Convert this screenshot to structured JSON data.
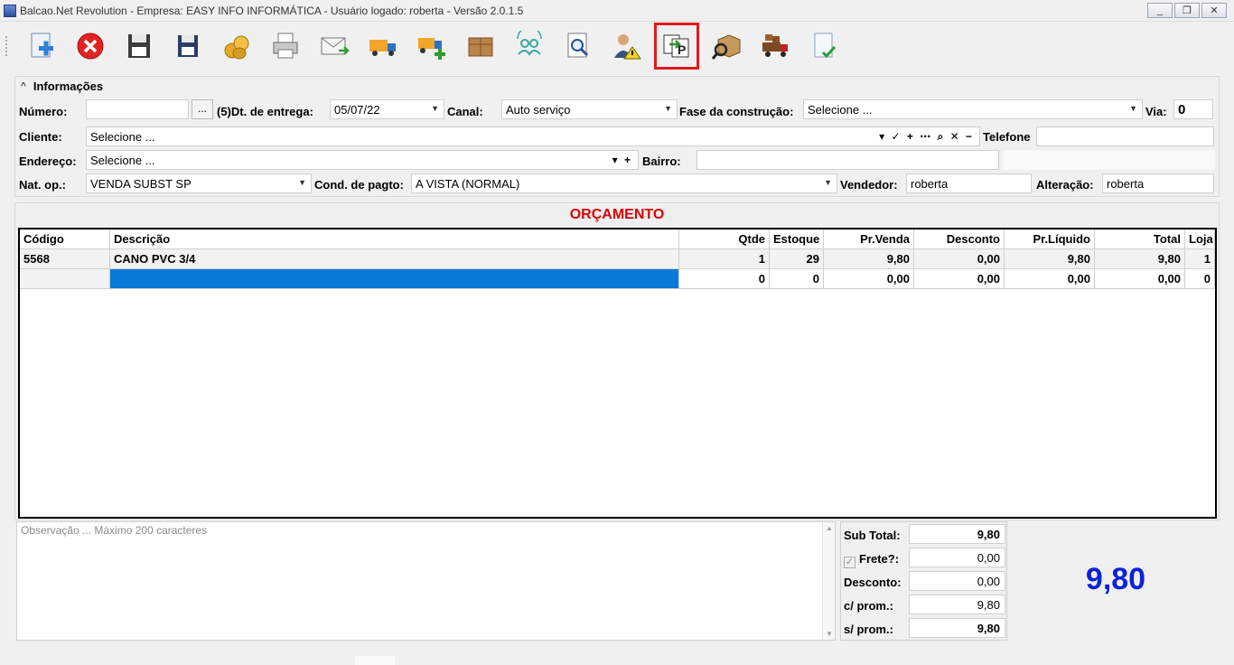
{
  "window": {
    "title": "Balcao.Net Revolution - Empresa: EASY INFO INFORMÁTICA - Usuário logado: roberta - Versão 2.0.1.5",
    "minimize": "_",
    "maximize": "❐",
    "close": "✕"
  },
  "toolbar": {
    "items": [
      {
        "name": "new-document-icon"
      },
      {
        "name": "cancel-icon"
      },
      {
        "name": "save-icon"
      },
      {
        "name": "save-as-icon"
      },
      {
        "name": "coins-icon"
      },
      {
        "name": "print-icon"
      },
      {
        "name": "email-icon"
      },
      {
        "name": "truck-icon"
      },
      {
        "name": "truck-add-icon"
      },
      {
        "name": "boxes-icon"
      },
      {
        "name": "users-sync-icon"
      },
      {
        "name": "document-search-icon"
      },
      {
        "name": "user-warning-icon"
      },
      {
        "name": "document-transfer-icon"
      },
      {
        "name": "package-search-icon"
      },
      {
        "name": "delivery-truck-icon"
      },
      {
        "name": "document-check-icon"
      }
    ],
    "highlighted_index": 13
  },
  "info": {
    "title": "Informações",
    "numero_label": "Número:",
    "numero_value": "",
    "dots": "...",
    "dt_entrega_label": "(5)Dt. de entrega:",
    "dt_entrega_value": "05/07/22",
    "canal_label": "Canal:",
    "canal_value": "Auto serviço",
    "fase_label": "Fase da construção:",
    "fase_value": "Selecione ...",
    "via_label": "Via:",
    "via_value": "0",
    "cliente_label": "Cliente:",
    "cliente_value": "Selecione ...",
    "cliente_actions": "▾ ✓ + ⋯ ⌕ ✕ −",
    "telefone_label": "Telefone",
    "telefone_value": "",
    "endereco_label": "Endereço:",
    "endereco_value": "Selecione ...",
    "endereco_actions": "▾ +",
    "bairro_label": "Bairro:",
    "bairro_value": "",
    "natop_label": "Nat. op.:",
    "natop_value": "VENDA SUBST SP",
    "cond_label": "Cond. de pagto:",
    "cond_value": "A VISTA (NORMAL)",
    "vendedor_label": "Vendedor:",
    "vendedor_value": "roberta",
    "alteracao_label": "Alteração:",
    "alteracao_value": "roberta"
  },
  "grid": {
    "title": "ORÇAMENTO",
    "columns": [
      "Código",
      "Descrição",
      "Qtde",
      "Estoque",
      "Pr.Venda",
      "Desconto",
      "Pr.Líquido",
      "Total",
      "Loja"
    ],
    "rows": [
      [
        "5568",
        "CANO PVC 3/4",
        "1",
        "29",
        "9,80",
        "0,00",
        "9,80",
        "9,80",
        "1"
      ],
      [
        "",
        "",
        "0",
        "0",
        "0,00",
        "0,00",
        "0,00",
        "0,00",
        "0"
      ]
    ]
  },
  "observacao_placeholder": "Observação ... Máximo 200 caracteres",
  "totals": {
    "subtotal_label": "Sub Total:",
    "subtotal_value": "9,80",
    "frete_label": "Frete?:",
    "frete_value": "0,00",
    "frete_checked": true,
    "desconto_label": "Desconto:",
    "desconto_value": "0,00",
    "cprom_label": "c/ prom.:",
    "cprom_value": "9,80",
    "sprom_label": "s/ prom.:",
    "sprom_value": "9,80",
    "grand_total": "9,80"
  },
  "colors": {
    "title_red": "#e00000",
    "total_blue": "#0b22d8",
    "selection_blue": "#0a78d7",
    "highlight_border": "#e0191e"
  }
}
